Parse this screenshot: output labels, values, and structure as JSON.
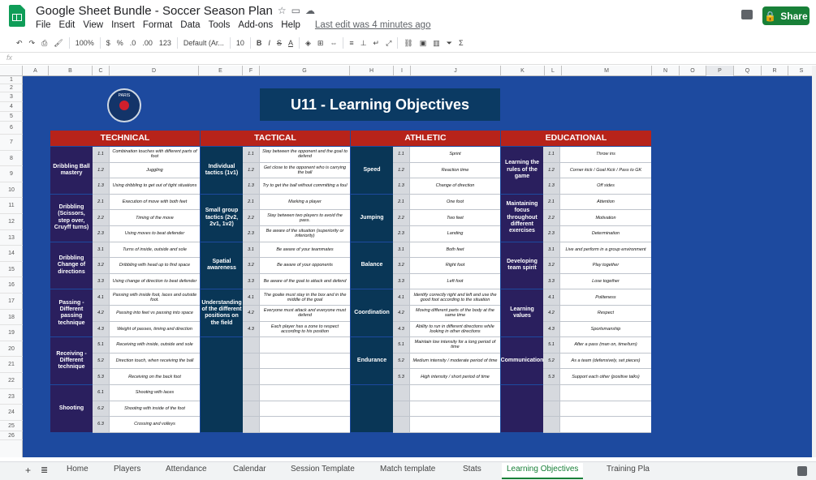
{
  "app": {
    "title": "Google Sheet Bundle - Soccer Season Plan",
    "last_edit": "Last edit was 4 minutes ago",
    "share_label": "Share",
    "menu": [
      "File",
      "Edit",
      "View",
      "Insert",
      "Format",
      "Data",
      "Tools",
      "Add-ons",
      "Help"
    ]
  },
  "toolbar": {
    "zoom": "100%",
    "currency": "$",
    "percent": "%",
    "dec_less": ".0",
    "dec_more": ".00",
    "more_formats": "123",
    "font": "Default (Ar...",
    "font_size": "10",
    "bold": "B",
    "italic": "I",
    "strike": "S",
    "text_color": "A",
    "sigma": "Σ"
  },
  "formula_bar": {
    "fx": "fx"
  },
  "columns": [
    "A",
    "B",
    "C",
    "D",
    "E",
    "F",
    "G",
    "H",
    "I",
    "J",
    "K",
    "L",
    "M",
    "N",
    "O",
    "P",
    "Q",
    "R",
    "S"
  ],
  "rows": [
    "1",
    "2",
    "3",
    "4",
    "5",
    "6",
    "7",
    "8",
    "9",
    "10",
    "11",
    "12",
    "13",
    "14",
    "15",
    "16",
    "17",
    "18",
    "19",
    "20",
    "21",
    "22",
    "23",
    "24",
    "25",
    "26"
  ],
  "sheet": {
    "title": "U11 - Learning Objectives",
    "crest_text": "PARIS",
    "sections": [
      "TECHNICAL",
      "TACTICAL",
      "ATHLETIC",
      "EDUCATIONAL"
    ]
  },
  "technical": {
    "categories": [
      "Dribbling Ball mastery",
      "Dribbling (Scissors, step over, Cruyff turns)",
      "Dribbling Change of directions",
      "Passing - Different passing technique",
      "Receiving - Different technique",
      "Shooting"
    ],
    "numbers": [
      "1.1",
      "1.2",
      "1.3",
      "2.1",
      "2.2",
      "2.3",
      "3.1",
      "3.2",
      "3.3",
      "4.1",
      "4.2",
      "4.3",
      "5.1",
      "5.2",
      "5.3",
      "6.1",
      "6.2",
      "6.3"
    ],
    "items": [
      "Combination touches with different parts of foot",
      "Juggling",
      "Using dribbling to get out of tight situations",
      "Execution of move with both feet",
      "Timing of the move",
      "Using moves to beat defender",
      "Turns of inside, outside and sole",
      "Dribbling with head up to find space",
      "Using change of direction to beat defender",
      "Passing with inside foot, laces and outside foot.",
      "Passing into feet vs passing into space",
      "Weight of passes, timing and direction",
      "Receiving with inside, outside and sole",
      "Direction touch, when receiving the ball",
      "Receiving on the back foot",
      "Shooting with laces",
      "Shooting with inside of the foot",
      "Crossing and volleys"
    ]
  },
  "tactical": {
    "categories": [
      "Individual tactics (1v1)",
      "Small group tactics (2v2, 2v1, 1v2)",
      "Spatial awareness",
      "Understanding of the different positions on the field"
    ],
    "numbers": [
      "1.1",
      "1.2",
      "1.3",
      "2.1",
      "2.2",
      "2.3",
      "3.1",
      "3.2",
      "3.3",
      "4.1",
      "4.2",
      "4.3"
    ],
    "items": [
      "Stay between the opponent and the goal to defend",
      "Get close to the opponent who is carrying the ball",
      "Try to get the ball without committing a foul",
      "Marking a player",
      "Stay between two players to avoid the pass.",
      "Be aware of the situation (superiority or inferiority)",
      "Be aware of your teammates",
      "Be aware of your opponents",
      "Be aware of the goal to attack and defend",
      "The goalie must stay in the box and in the middle of the goal",
      "Everyone must attack and everyone must defend",
      "Each player has a zone to respect according to his position"
    ]
  },
  "athletic": {
    "categories": [
      "Speed",
      "Jumping",
      "Balance",
      "Coordination",
      "Endurance"
    ],
    "numbers": [
      "1.1",
      "1.2",
      "1.3",
      "2.1",
      "2.2",
      "2.3",
      "3.1",
      "3.2",
      "3.3",
      "4.1",
      "4.2",
      "4.3",
      "5.1",
      "5.2",
      "5.3"
    ],
    "items": [
      "Sprint",
      "Reaction time",
      "Change of direction",
      "One foot",
      "Two feet",
      "Landing",
      "Both feet",
      "Right foot",
      "Left foot",
      "Identify correctly right and left and use the good foot according to the situation",
      "Moving different parts of the body at the same time",
      "Ability to run in different directions while looking in other directions",
      "Maintain low intensity for a long period of time",
      "Medium intensity / moderate period of time",
      "High intensity / short period of time"
    ]
  },
  "educational": {
    "categories": [
      "Learning the rules of the game",
      "Maintaining focus throughout different exercises",
      "Developing team spirit",
      "Learning values",
      "Communication"
    ],
    "numbers": [
      "1.1",
      "1.2",
      "1.3",
      "2.1",
      "2.2",
      "2.3",
      "3.1",
      "3.2",
      "3.3",
      "4.1",
      "4.2",
      "4.3",
      "5.1",
      "5.2",
      "5.3"
    ],
    "items": [
      "Throw ins",
      "Corner kick / Goal Kick / Pass to GK",
      "Off sides",
      "Attention",
      "Motivation",
      "Determination",
      "Live and perform in a group environment",
      "Play together",
      "Lose together",
      "Politeness",
      "Respect",
      "Sportsmanship",
      "After a pass (man on, time/turn)",
      "As a team (defensively, set pieces)",
      "Support each other (positive talks)"
    ]
  },
  "tabs": [
    "Home",
    "Players",
    "Attendance",
    "Calendar",
    "Session Template",
    "Match template",
    "Stats",
    "Learning Objectives",
    "Training Pla"
  ],
  "active_tab": "Learning Objectives",
  "colors": {
    "sheet_bg": "#1d4a9f",
    "header_red": "#b7231a",
    "title_bg": "#0b3a63",
    "tech_cat": "#2a1f5e",
    "tac_cat": "#093656",
    "share": "#188038"
  }
}
